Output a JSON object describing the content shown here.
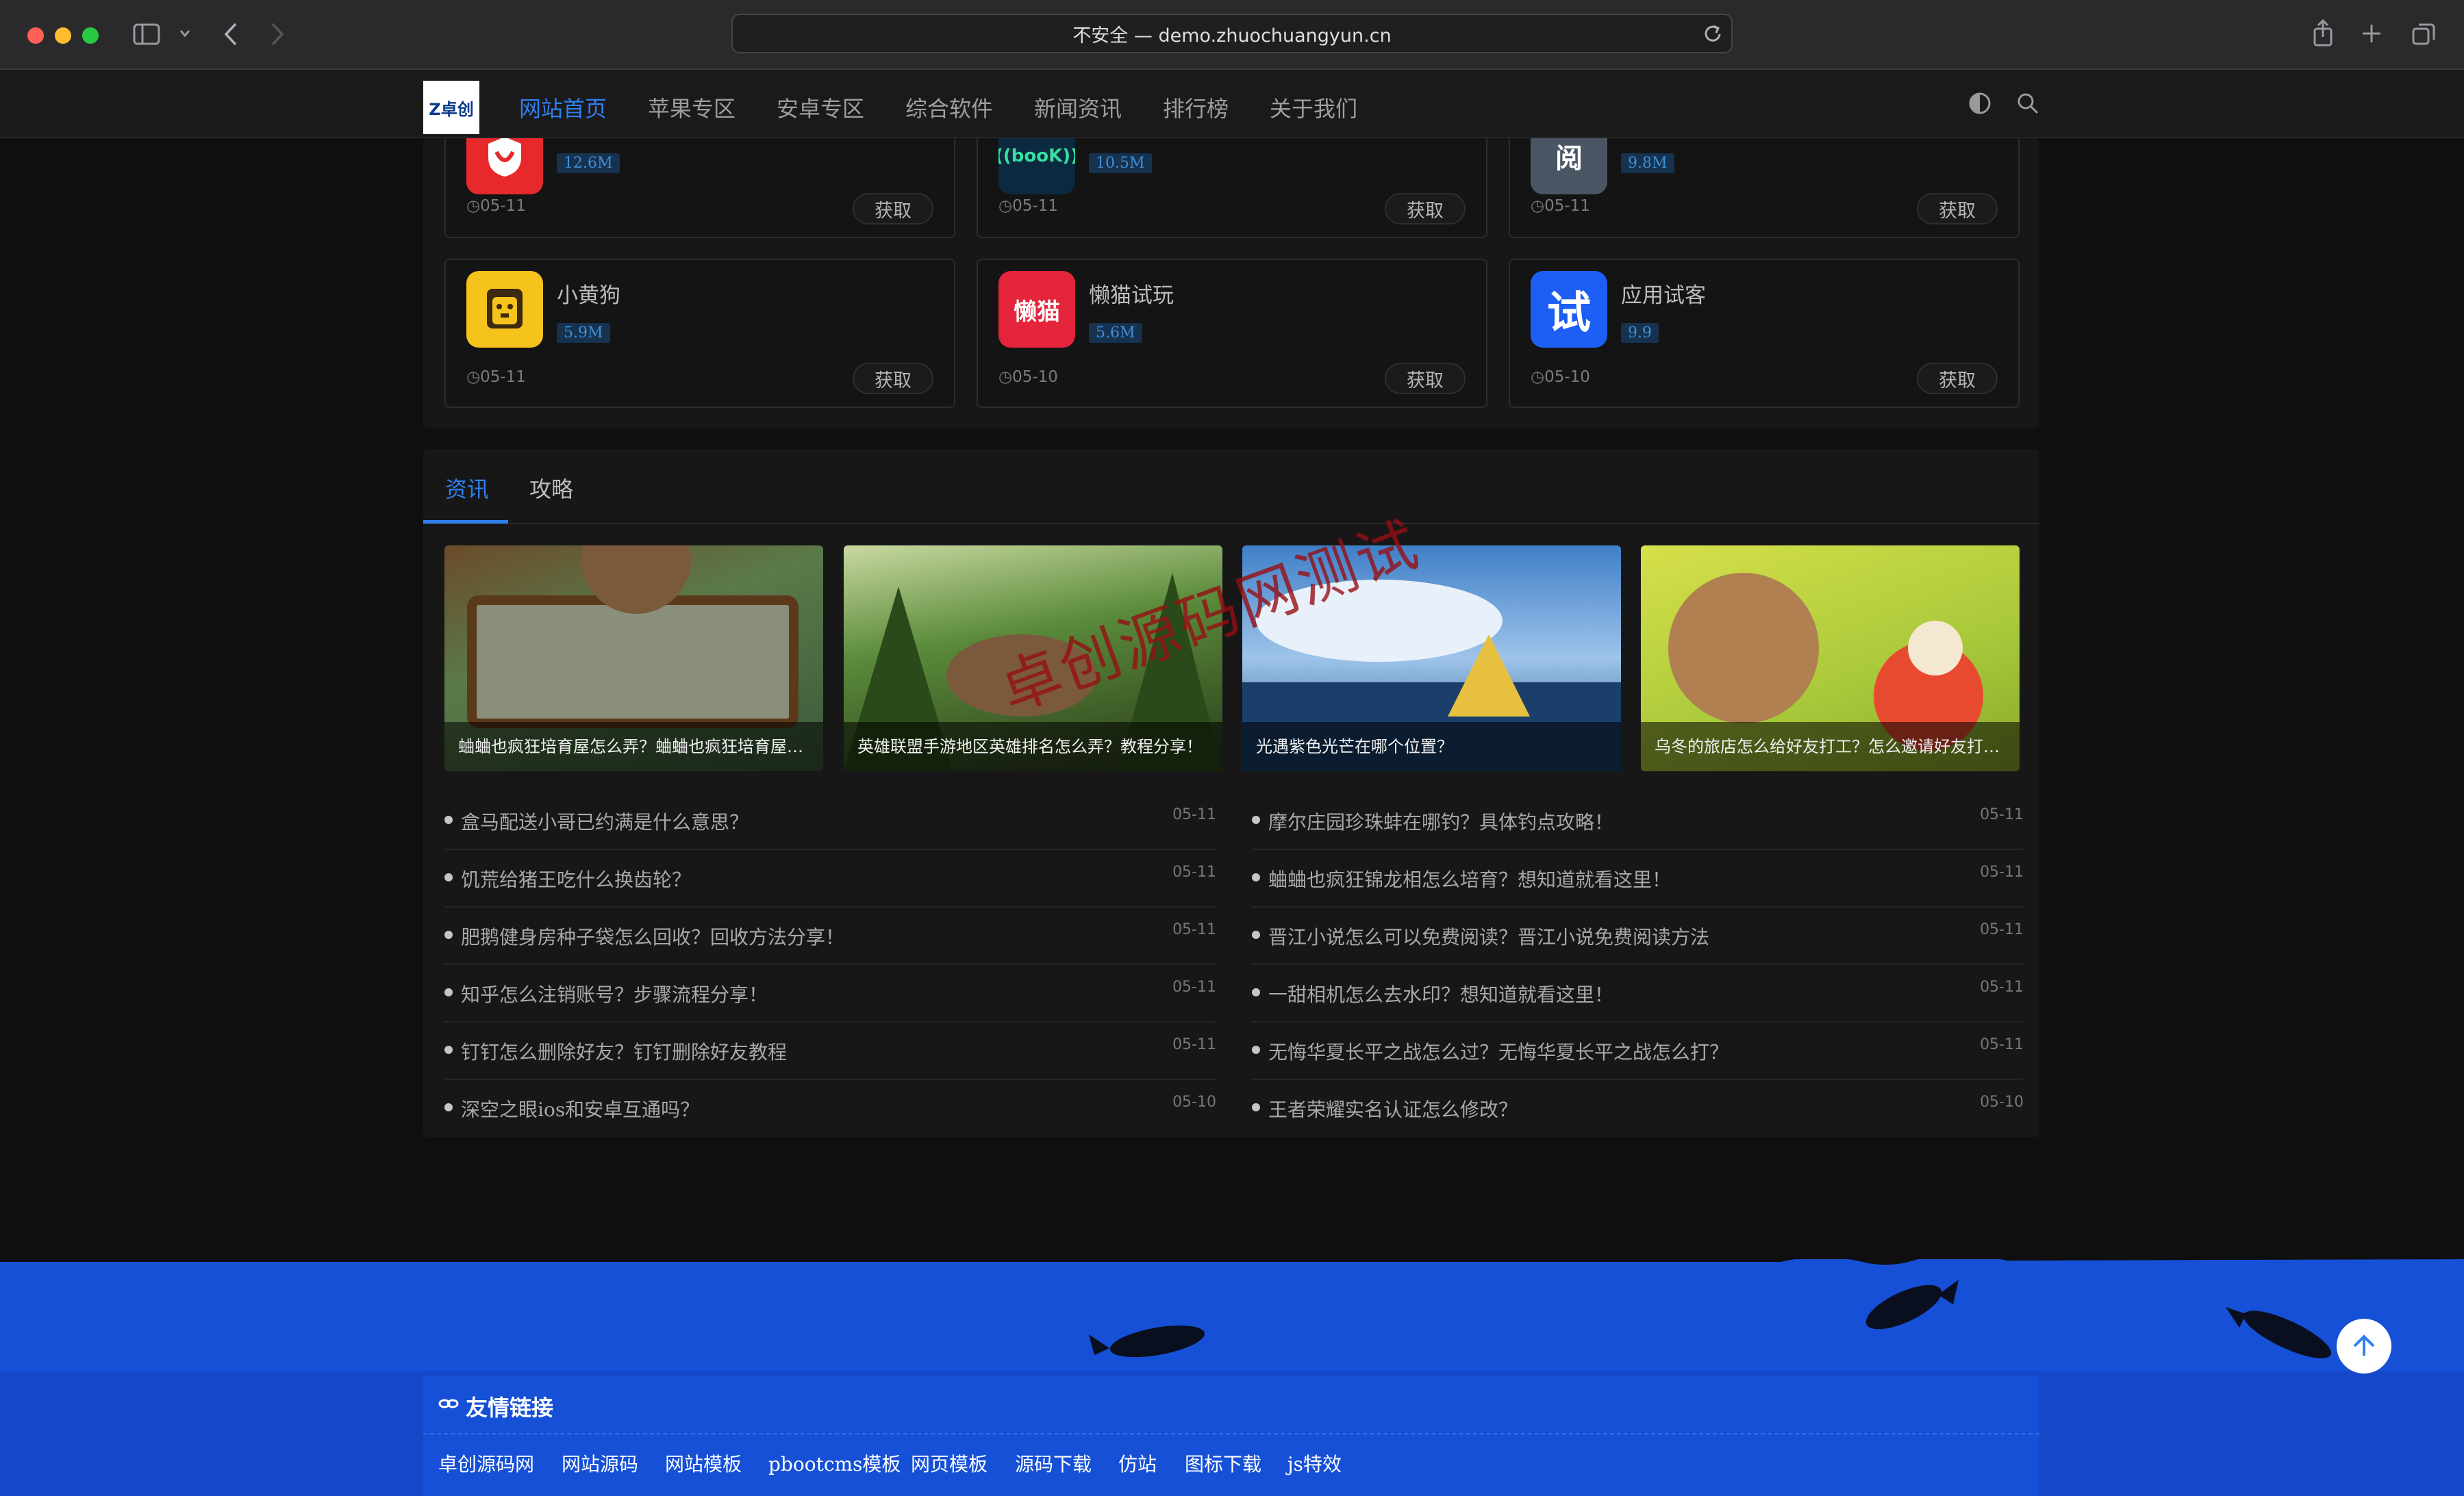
{
  "browser": {
    "url": "不安全 — demo.zhuochuangyun.cn",
    "colors": {
      "close": "#ff5f57",
      "minimize": "#febc2e",
      "maximize": "#28c840"
    }
  },
  "site": {
    "logo_text": "Z卓创",
    "nav": [
      "网站首页",
      "苹果专区",
      "安卓专区",
      "综合软件",
      "新闻资讯",
      "排行榜",
      "关于我们"
    ],
    "accent": "#2f7ff0"
  },
  "apps_top": [
    {
      "size": "12.6M",
      "date": "05-11",
      "button": "获取",
      "icon_color": "#e8292b"
    },
    {
      "size": "10.5M",
      "date": "05-11",
      "button": "获取",
      "icon_text": "((booK))",
      "icon_color": "#0c2a3f"
    },
    {
      "size": "9.8M",
      "date": "05-11",
      "button": "获取",
      "icon_text": "阅",
      "icon_color": "#4a5563"
    }
  ],
  "apps": [
    {
      "name": "小黄狗",
      "size": "5.9M",
      "date": "05-11",
      "button": "获取",
      "icon_color": "#f6c21c"
    },
    {
      "name": "懒猫试玩",
      "size": "5.6M",
      "date": "05-10",
      "button": "获取",
      "icon_text": "懒猫",
      "icon_color": "#e3243a"
    },
    {
      "name": "应用试客",
      "size": "9.9",
      "date": "05-10",
      "button": "获取",
      "icon_text": "试",
      "icon_color": "#1d5ff5"
    }
  ],
  "news": {
    "tabs": [
      "资讯",
      "攻略"
    ],
    "thumbs": [
      {
        "caption": "蛐蛐也疯狂培育屋怎么弄？蛐蛐也疯狂培育屋…",
        "color": "#5a7a4a"
      },
      {
        "caption": "英雄联盟手游地区英雄排名怎么弄？教程分享！",
        "color": "#3d5a2a"
      },
      {
        "caption": "光遇紫色光芒在哪个位置？",
        "color": "#6aa0d8"
      },
      {
        "caption": "乌冬的旅店怎么给好友打工？怎么邀请好友打…",
        "color": "#c7d43a"
      }
    ],
    "left": [
      {
        "title": "盒马配送小哥已约满是什么意思？",
        "date": "05-11"
      },
      {
        "title": "饥荒给猪王吃什么换齿轮？",
        "date": "05-11"
      },
      {
        "title": "肥鹅健身房种子袋怎么回收？回收方法分享！",
        "date": "05-11"
      },
      {
        "title": "知乎怎么注销账号？步骤流程分享！",
        "date": "05-11"
      },
      {
        "title": "钉钉怎么删除好友？钉钉删除好友教程",
        "date": "05-11"
      },
      {
        "title": "深空之眼ios和安卓互通吗？",
        "date": "05-10"
      }
    ],
    "right": [
      {
        "title": "摩尔庄园珍珠蚌在哪钓？具体钓点攻略！",
        "date": "05-11"
      },
      {
        "title": "蛐蛐也疯狂锦龙相怎么培育？想知道就看这里！",
        "date": "05-11"
      },
      {
        "title": "晋江小说怎么可以免费阅读？晋江小说免费阅读方法",
        "date": "05-11"
      },
      {
        "title": "一甜相机怎么去水印？想知道就看这里！",
        "date": "05-11"
      },
      {
        "title": "无悔华夏长平之战怎么过？无悔华夏长平之战怎么打？",
        "date": "05-11"
      },
      {
        "title": "王者荣耀实名认证怎么修改？",
        "date": "05-10"
      }
    ],
    "watermark": "卓创源码网测试"
  },
  "footer": {
    "title": "友情链接",
    "links": [
      "卓创源码网",
      "网站源码",
      "网站模板",
      "pbootcms模板",
      "网页模板",
      "源码下载",
      "仿站",
      "图标下载",
      "js特效"
    ],
    "color": "#1550d6"
  }
}
